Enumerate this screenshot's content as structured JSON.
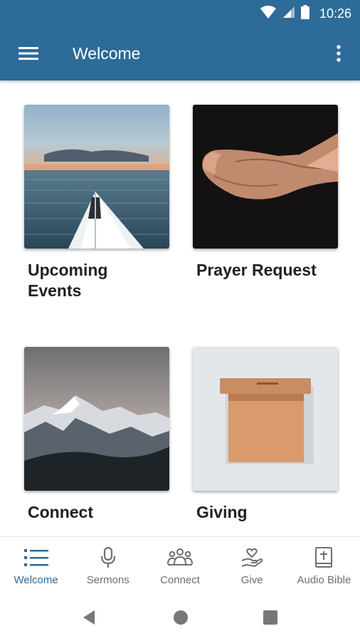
{
  "status_bar": {
    "time": "10:26",
    "icons": [
      "wifi-icon",
      "cell-signal-icon",
      "battery-icon"
    ]
  },
  "app_bar": {
    "title": "Welcome",
    "menu_icon": "hamburger-menu-icon",
    "overflow_icon": "more-vert-icon"
  },
  "tiles": [
    {
      "label": "Upcoming\nEvents",
      "image": "kayak-on-lake-photo"
    },
    {
      "label": "Prayer Request",
      "image": "open-hands-photo"
    },
    {
      "label": "Connect",
      "image": "snowy-mountains-photo"
    },
    {
      "label": "Giving",
      "image": "wooden-offering-box-photo"
    }
  ],
  "bottom_nav": [
    {
      "label": "Welcome",
      "icon": "list-icon",
      "active": true
    },
    {
      "label": "Sermons",
      "icon": "microphone-icon",
      "active": false
    },
    {
      "label": "Connect",
      "icon": "group-icon",
      "active": false
    },
    {
      "label": "Give",
      "icon": "hand-heart-icon",
      "active": false
    },
    {
      "label": "Audio Bible",
      "icon": "bible-icon",
      "active": false
    }
  ],
  "system_nav": [
    "back-icon",
    "home-icon",
    "recents-icon"
  ],
  "colors": {
    "primary": "#2d6b99",
    "nav_inactive": "#6f6f6f",
    "tile_text": "#212121"
  }
}
